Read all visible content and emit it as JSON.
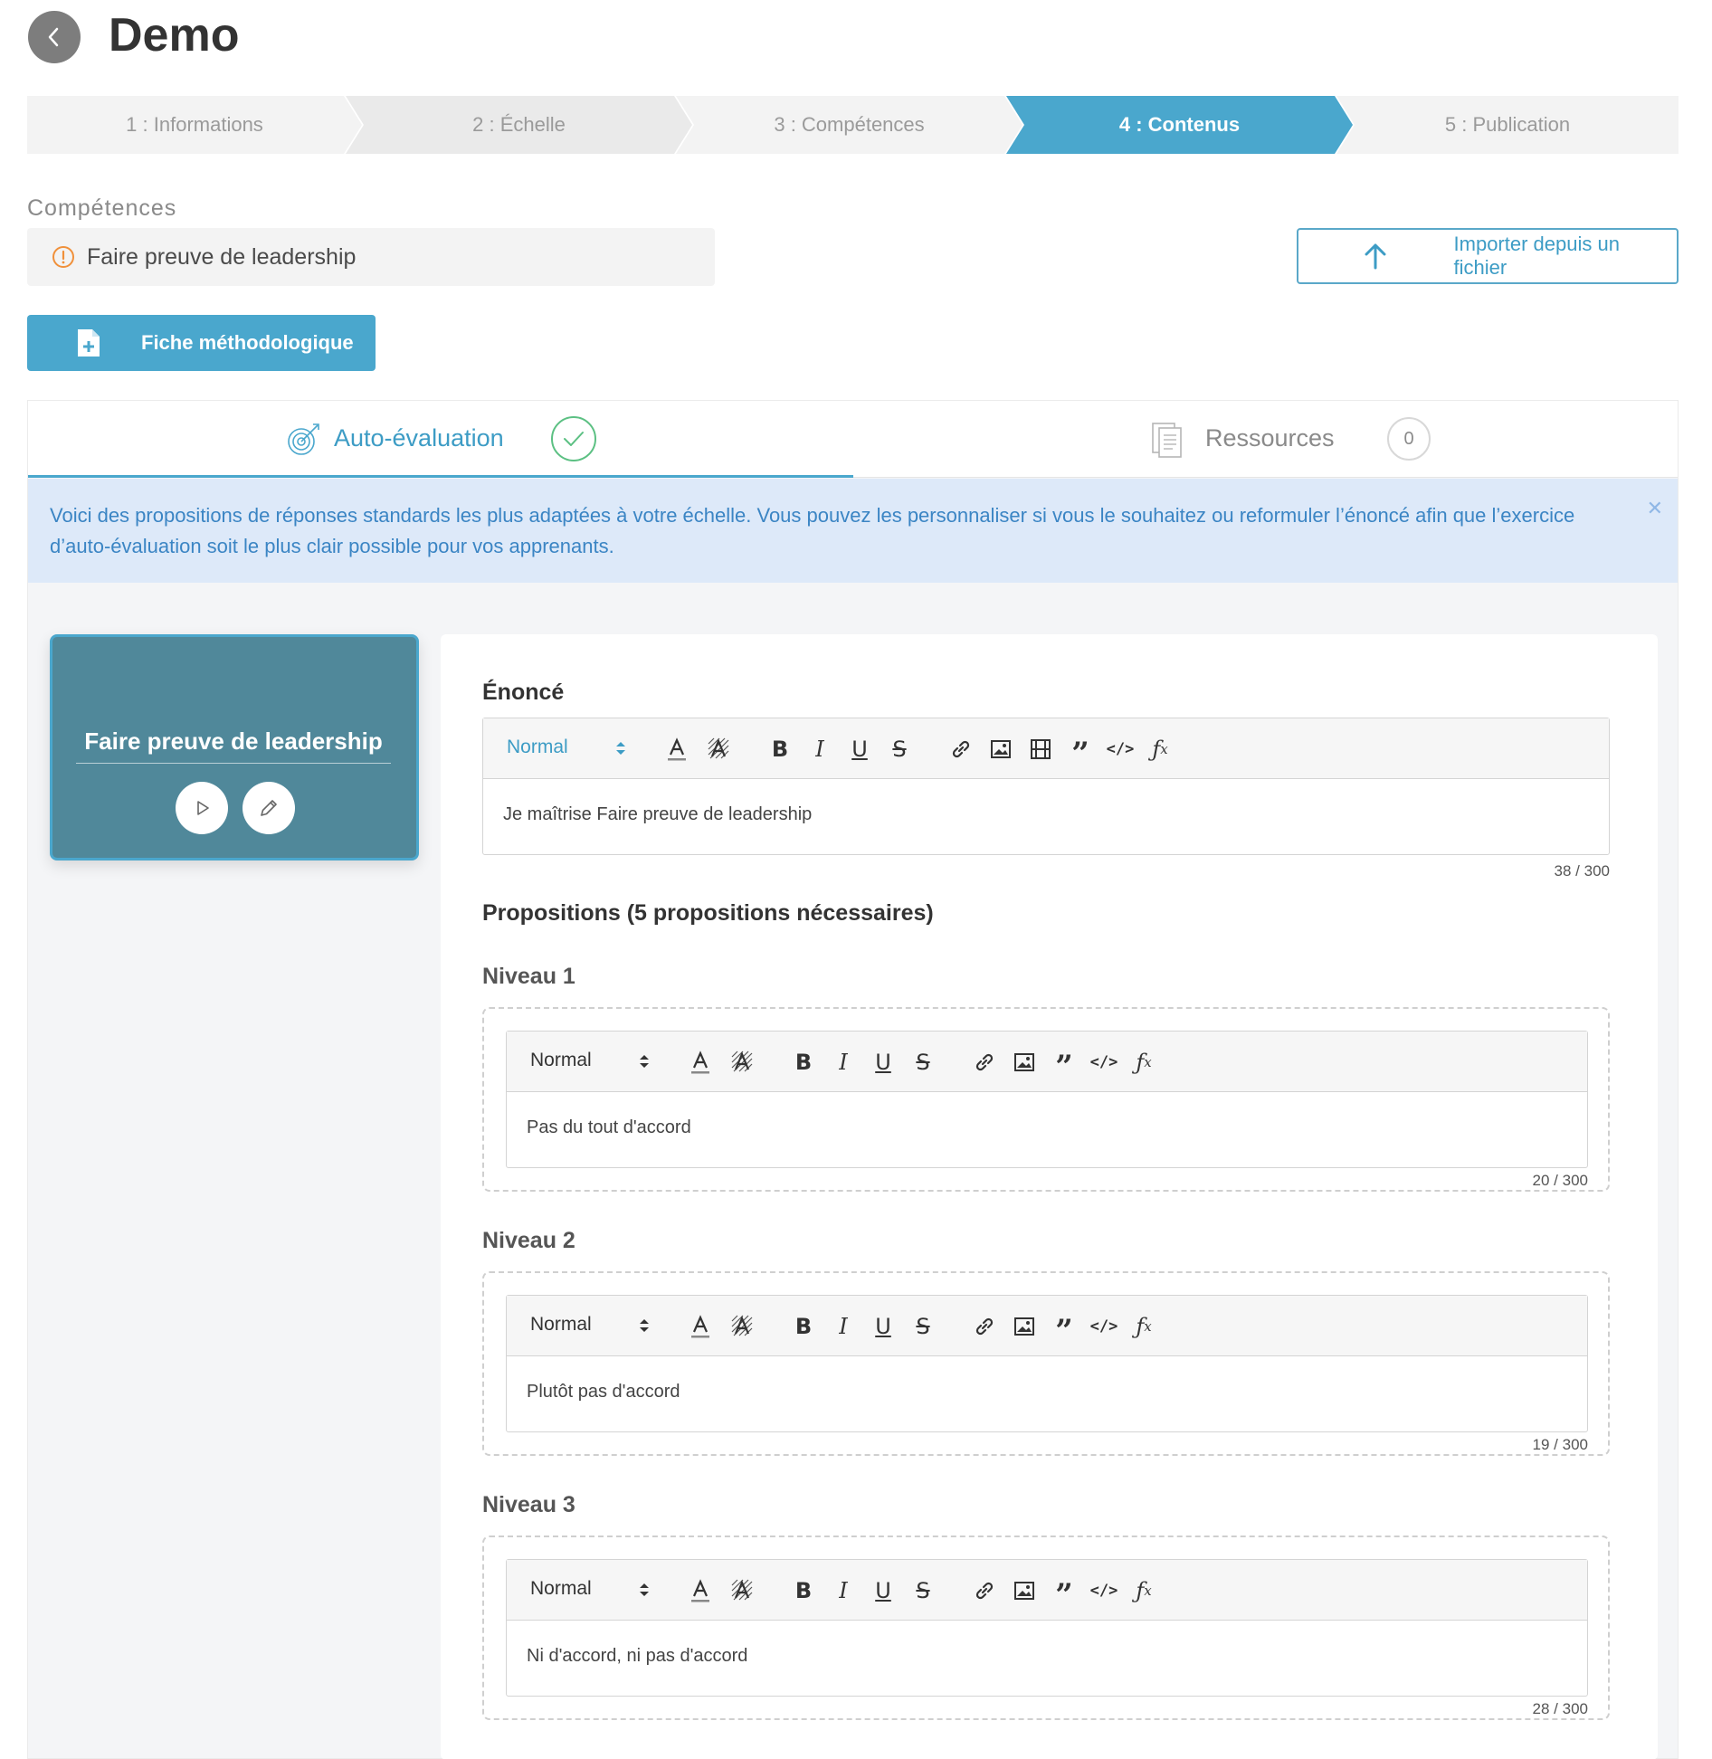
{
  "header": {
    "title": "Demo"
  },
  "stepper": [
    {
      "label": "1 : Informations",
      "active": false
    },
    {
      "label": "2 : Échelle",
      "active": false
    },
    {
      "label": "3 : Compétences",
      "active": false
    },
    {
      "label": "4 : Contenus",
      "active": true
    },
    {
      "label": "5 : Publication",
      "active": false
    }
  ],
  "competences": {
    "section_label": "Compétences",
    "selected": "Faire preuve de leadership",
    "import_label": "Importer depuis un fichier",
    "fiche_label": "Fiche méthodologique"
  },
  "tabs": {
    "auto": {
      "label": "Auto-évaluation"
    },
    "resources": {
      "label": "Ressources",
      "count": "0"
    }
  },
  "banner": {
    "text": "Voici des propositions de réponses standards les plus adaptées à votre échelle. Vous pouvez les personnaliser si vous le souhaitez ou reformuler l’énoncé afin que l’exercice d’auto-évaluation soit le plus clair possible pour vos apprenants."
  },
  "card": {
    "title": "Faire preuve de leadership"
  },
  "enonce": {
    "label": "Énoncé",
    "format": "Normal",
    "content": "Je maîtrise Faire preuve de leadership",
    "counter": "38 / 300"
  },
  "propositions": {
    "heading": "Propositions (5 propositions nécessaires)",
    "levels": [
      {
        "label": "Niveau 1",
        "format": "Normal",
        "content": "Pas du tout d'accord",
        "counter": "20 / 300"
      },
      {
        "label": "Niveau 2",
        "format": "Normal",
        "content": "Plutôt pas d'accord",
        "counter": "19 / 300"
      },
      {
        "label": "Niveau 3",
        "format": "Normal",
        "content": "Ni d'accord, ni pas d'accord",
        "counter": "28 / 300"
      }
    ]
  },
  "colors": {
    "accent": "#4aa7cd",
    "card_bg": "#50889a",
    "banner_bg": "#dde9f9",
    "success": "#5cc083"
  }
}
